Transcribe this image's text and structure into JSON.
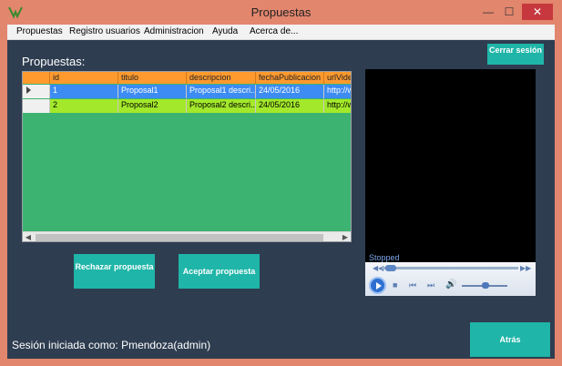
{
  "window": {
    "title": "Propuestas",
    "controls": {
      "minimize": "—",
      "maximize": "☐",
      "close": "✕"
    }
  },
  "menu": [
    "Propuestas",
    "Registro usuarios",
    "Administracion",
    "Ayuda",
    "Acerca de..."
  ],
  "header": {
    "section_label": "Propuestas:",
    "logout_label": "Cerrar sesión"
  },
  "grid": {
    "columns": [
      "id",
      "titulo",
      "descripcion",
      "fechaPublicacion",
      "urlVideo"
    ],
    "rows": [
      {
        "id": "1",
        "titulo": "Proposal1",
        "descripcion": "Proposal1 descri...",
        "fecha": "24/05/2016",
        "url": "http://w"
      },
      {
        "id": "2",
        "titulo": "Proposal2",
        "descripcion": "Proposal2 descri...",
        "fecha": "24/05/2016",
        "url": "http://w"
      }
    ]
  },
  "actions": {
    "reject_label": "Rechazar propuesta",
    "accept_label": "Aceptar propuesta",
    "back_label": "Atrás"
  },
  "player": {
    "status": "Stopped"
  },
  "footer": {
    "session_text": "Sesión iniciada como: Pmendoza(admin)"
  },
  "colors": {
    "window_frame": "#e2866e",
    "client_bg": "#2e3d50",
    "teal_button": "#1fb5a8",
    "grid_bg": "#3cb371",
    "header_orange": "#ff9a2e",
    "selected_row": "#3d8cf3",
    "row2_green": "#a3e82a",
    "close_red": "#c7383e"
  }
}
